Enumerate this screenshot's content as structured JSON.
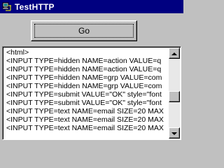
{
  "window": {
    "title": "TestHTTP",
    "icon": "network-computer-icon"
  },
  "go_button": {
    "label": "Go"
  },
  "output": {
    "lines": [
      "<html>",
      "<INPUT TYPE=hidden NAME=action VALUE=q",
      "<INPUT TYPE=hidden NAME=action VALUE=q",
      "<INPUT TYPE=hidden NAME=grp VALUE=com",
      "<INPUT TYPE=hidden NAME=grp VALUE=com",
      "<INPUT TYPE=submit VALUE=\"OK\" style=\"font",
      "<INPUT TYPE=submit VALUE=\"OK\" style=\"font",
      "<INPUT TYPE=text NAME=email SIZE=20 MAX",
      "<INPUT TYPE=text NAME=email SIZE=20 MAX",
      "<INPUT TYPE=text NAME=email SIZE=20 MAX"
    ]
  },
  "scrollbar": {
    "up_icon": "scroll-up-arrow-icon",
    "down_icon": "scroll-down-arrow-icon"
  }
}
